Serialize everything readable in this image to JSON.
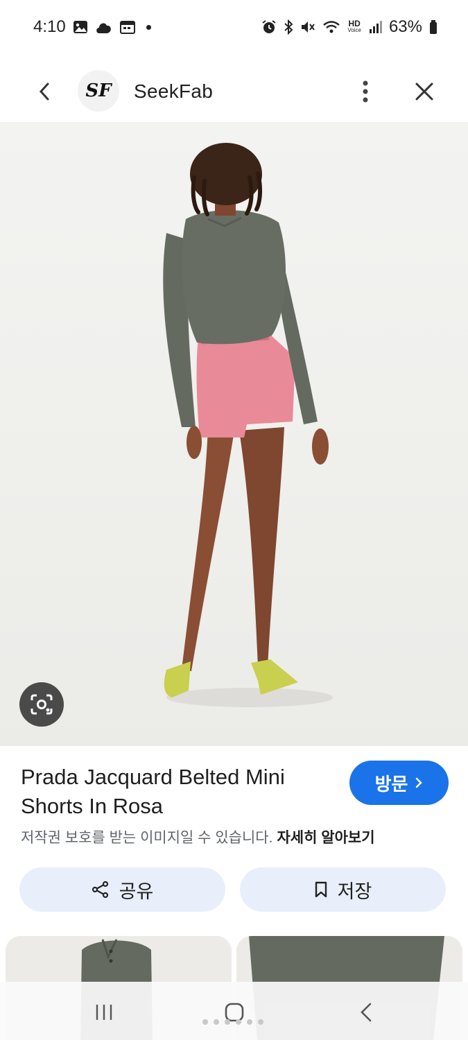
{
  "status_bar": {
    "time": "4:10",
    "battery": "63%",
    "network_label": "HD",
    "network_sub": "Voice",
    "icons_left": [
      "gallery-icon",
      "cloud-icon",
      "calendar-icon",
      "dot-icon"
    ],
    "icons_right": [
      "alarm-icon",
      "bluetooth-icon",
      "mute-icon",
      "wifi-icon",
      "hd-voice-icon",
      "signal-icon",
      "battery-icon"
    ]
  },
  "header": {
    "site_name": "SeekFab",
    "logo_text": "SF"
  },
  "product": {
    "title": "Prada Jacquard Belted Mini Shorts In Rosa",
    "visit_label": "방문",
    "copyright_notice": "저작권 보호를 받는 이미지일 수 있습니다.",
    "learn_more": "자세히 알아보기"
  },
  "actions": {
    "share_label": "공유",
    "save_label": "저장"
  },
  "colors": {
    "accent": "#1a73e8",
    "action_bg": "#e8effa",
    "sweater": "#646a60",
    "shorts": "#e98a98",
    "shoes": "#c9cf4f",
    "skin": "#8a4e34"
  }
}
